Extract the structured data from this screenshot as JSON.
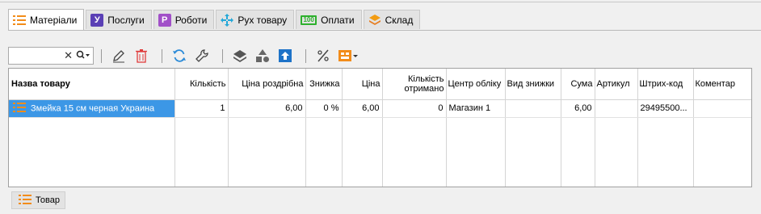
{
  "tabs": [
    {
      "label": "Матеріали",
      "icon": "list-icon",
      "active": true
    },
    {
      "label": "Послуги",
      "icon": "services-icon",
      "active": false
    },
    {
      "label": "Роботи",
      "icon": "works-icon",
      "active": false
    },
    {
      "label": "Рух товару",
      "icon": "move-arrows-icon",
      "active": false
    },
    {
      "label": "Оплати",
      "icon": "payment-icon",
      "active": false
    },
    {
      "label": "Склад",
      "icon": "stack-icon",
      "active": false
    }
  ],
  "tab_glyphs": {
    "services": "У",
    "works": "Р",
    "payment": "100"
  },
  "search": {
    "value": "",
    "placeholder": ""
  },
  "toolbar": {
    "icons": [
      "edit-icon",
      "delete-icon",
      "refresh-icon",
      "wrench-icon",
      "layers-icon",
      "shapes-icon",
      "upload-icon",
      "percent-icon",
      "view-menu-icon"
    ]
  },
  "grid": {
    "columns": [
      "Назва товару",
      "Кількість",
      "Ціна роздрібна",
      "Знижка",
      "Ціна",
      "Кількість отримано",
      "Центр обліку",
      "Вид знижки",
      "Сума",
      "Артикул",
      "Штрих-код",
      "Коментар"
    ],
    "rows": [
      {
        "name": "Змейка 15 см черная Украина",
        "quantity": "1",
        "retail_price": "6,00",
        "discount": "0 %",
        "price": "6,00",
        "received": "0",
        "center": "Магазин 1",
        "discount_type": "",
        "sum": "6,00",
        "article": "",
        "barcode": "29495500...",
        "comment": ""
      }
    ]
  },
  "bottom": {
    "button_label": "Товар"
  },
  "colors": {
    "selection": "#3c97e6",
    "accent_orange": "#f28c1a",
    "services_purple": "#5a3fb5",
    "works_purple": "#a150c8"
  }
}
